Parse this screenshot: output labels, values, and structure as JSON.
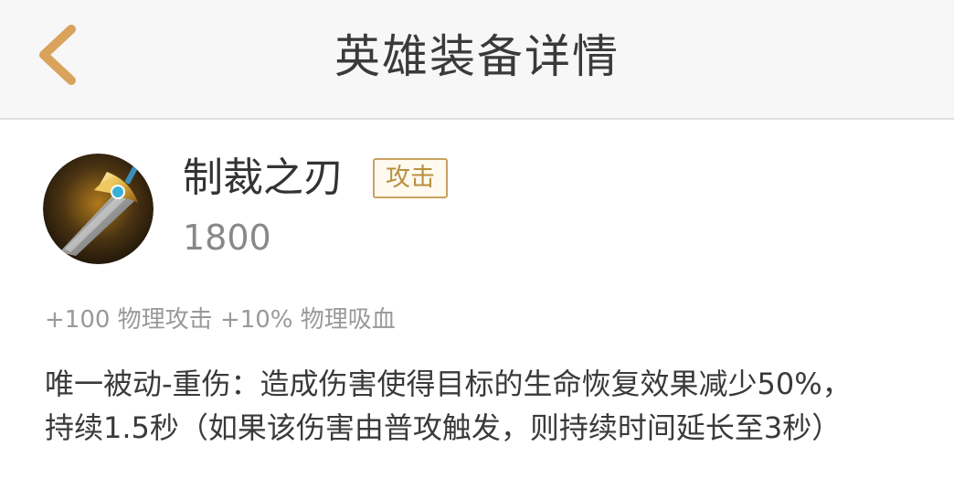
{
  "header": {
    "title": "英雄装备详情",
    "back_icon": "chevron-left-icon",
    "accent_color": "#d9a35b"
  },
  "item": {
    "icon": "sword-item-icon",
    "name": "制裁之刃",
    "tag": "攻击",
    "price": "1800",
    "stats": "+100 物理攻击 +10% 物理吸血",
    "description_lines": [
      "唯一被动-重伤：造成伤害使得目标的生命恢复效果减少50%，",
      "持续1.5秒（如果该伤害由普攻触发，则持续时间延长至3秒）"
    ]
  }
}
